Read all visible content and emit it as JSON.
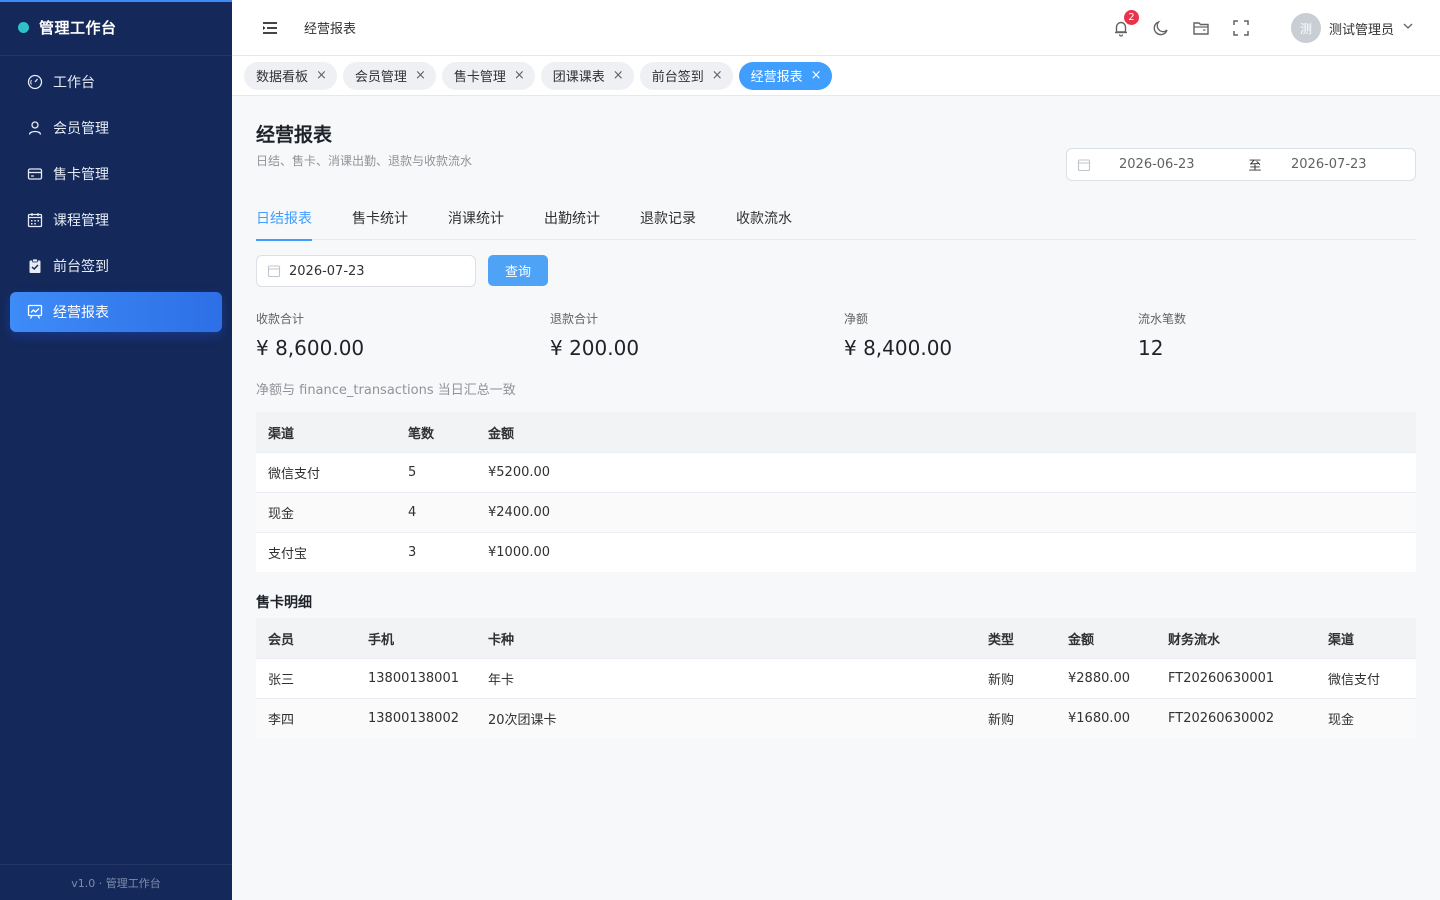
{
  "sidebar": {
    "brand": "管理工作台",
    "items": [
      {
        "label": "工作台",
        "icon": "dashboard-icon"
      },
      {
        "label": "会员管理",
        "icon": "user-icon"
      },
      {
        "label": "售卡管理",
        "icon": "card-icon"
      },
      {
        "label": "课程管理",
        "icon": "calendar-icon"
      },
      {
        "label": "前台签到",
        "icon": "clipboard-check-icon"
      },
      {
        "label": "经营报表",
        "icon": "report-icon"
      }
    ],
    "active_index": 5,
    "footer": "v1.0 · 管理工作台"
  },
  "header": {
    "title": "经营报表",
    "notification_count": "2",
    "user": {
      "avatar_text": "测",
      "name": "测试管理员"
    }
  },
  "tabs": [
    {
      "label": "数据看板",
      "close": "×"
    },
    {
      "label": "会员管理",
      "close": "×"
    },
    {
      "label": "售卡管理",
      "close": "×"
    },
    {
      "label": "团课课表",
      "close": "×"
    },
    {
      "label": "前台签到",
      "close": "×"
    },
    {
      "label": "经营报表",
      "close": "×"
    }
  ],
  "page": {
    "title": "经营报表",
    "subtitle": "日结、售卡、消课出勤、退款与收款流水",
    "range": {
      "start": "2026-06-23",
      "separator": "至",
      "end": "2026-07-23"
    },
    "subtabs": [
      "日结报表",
      "售卡统计",
      "消课统计",
      "出勤统计",
      "退款记录",
      "收款流水"
    ],
    "date_value": "2026-07-23",
    "query_label": "查询",
    "stats": [
      {
        "label": "收款合计",
        "value": "¥ 8,600.00"
      },
      {
        "label": "退款合计",
        "value": "¥ 200.00"
      },
      {
        "label": "净额",
        "value": "¥ 8,400.00"
      },
      {
        "label": "流水笔数",
        "value": "12"
      }
    ],
    "note": "净额与 finance_transactions 当日汇总一致",
    "channel_table": {
      "headers": [
        "渠道",
        "笔数",
        "金额"
      ],
      "rows": [
        [
          "微信支付",
          "5",
          "¥5200.00"
        ],
        [
          "现金",
          "4",
          "¥2400.00"
        ],
        [
          "支付宝",
          "3",
          "¥1000.00"
        ]
      ]
    },
    "card_section_title": "售卡明细",
    "card_table": {
      "headers": [
        "会员",
        "手机",
        "卡种",
        "类型",
        "金额",
        "财务流水",
        "渠道"
      ],
      "rows": [
        [
          "张三",
          "13800138001",
          "年卡",
          "新购",
          "¥2880.00",
          "FT20260630001",
          "微信支付"
        ],
        [
          "李四",
          "13800138002",
          "20次团课卡",
          "新购",
          "¥1680.00",
          "FT20260630002",
          "现金"
        ]
      ]
    }
  },
  "colors": {
    "sidebar_bg": "#14285a",
    "accent": "#409eff",
    "badge": "#e8334a",
    "brand_dot": "#2ec1c9"
  }
}
